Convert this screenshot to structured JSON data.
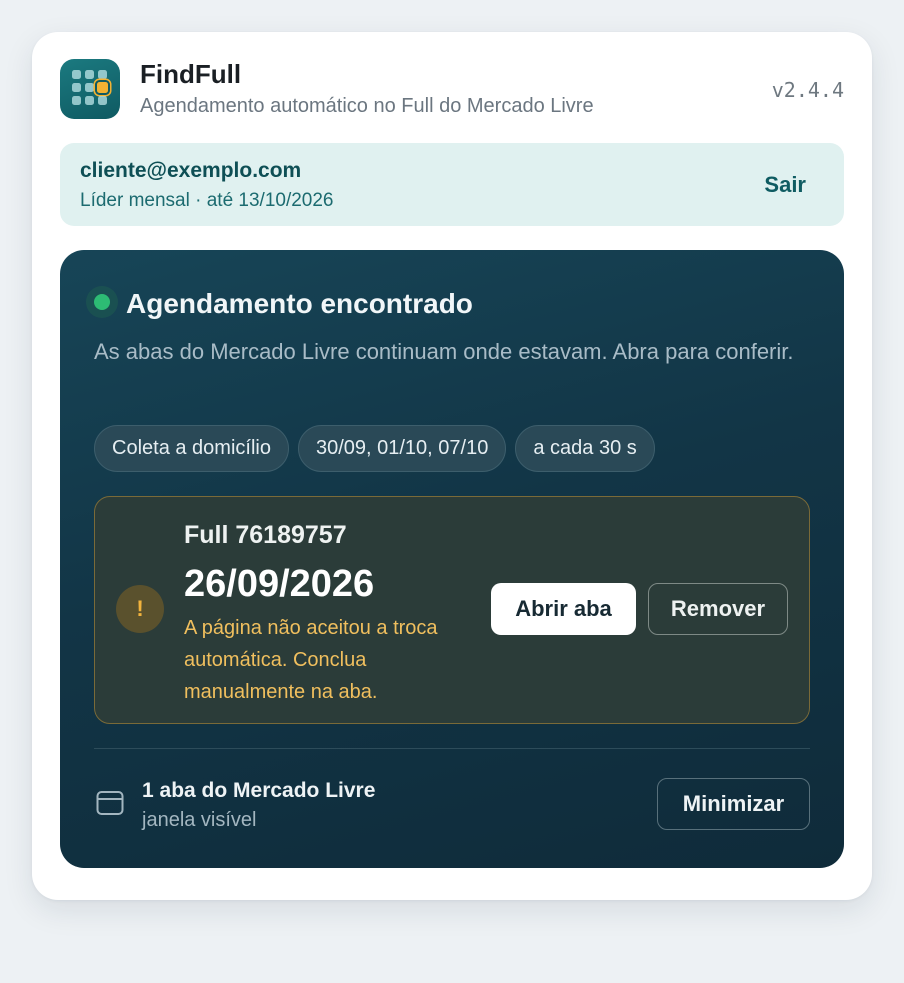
{
  "app": {
    "title": "FindFull",
    "subtitle": "Agendamento automático no Full do Mercado Livre",
    "version": "v2.4.4",
    "logo_icon": "calendar-grid-icon"
  },
  "account": {
    "email": "cliente@exemplo.com",
    "plan": "Líder mensal · até 13/10/2026",
    "logout_label": "Sair"
  },
  "status": {
    "state": "success",
    "indicator_color": "#2dbb74",
    "title": "Agendamento encontrado",
    "description": "As abas do Mercado Livre continuam onde estavam. Abra para conferir.",
    "chips": [
      "Coleta a domicílio",
      "30/09, 01/10, 07/10",
      "a cada 30 s"
    ]
  },
  "booking": {
    "id_label": "Full 76189757",
    "date": "26/09/2026",
    "warning_icon": "exclamation-icon",
    "warning_color": "#f0bf5e",
    "warning_text": "A página não aceitou a troca automática. Conclua manualmente na aba.",
    "open_label": "Abrir aba",
    "remove_label": "Remover"
  },
  "tabs": {
    "icon": "browser-window-icon",
    "count_label": "1 aba do Mercado Livre",
    "state_label": "janela visível",
    "minimize_label": "Minimizar"
  }
}
